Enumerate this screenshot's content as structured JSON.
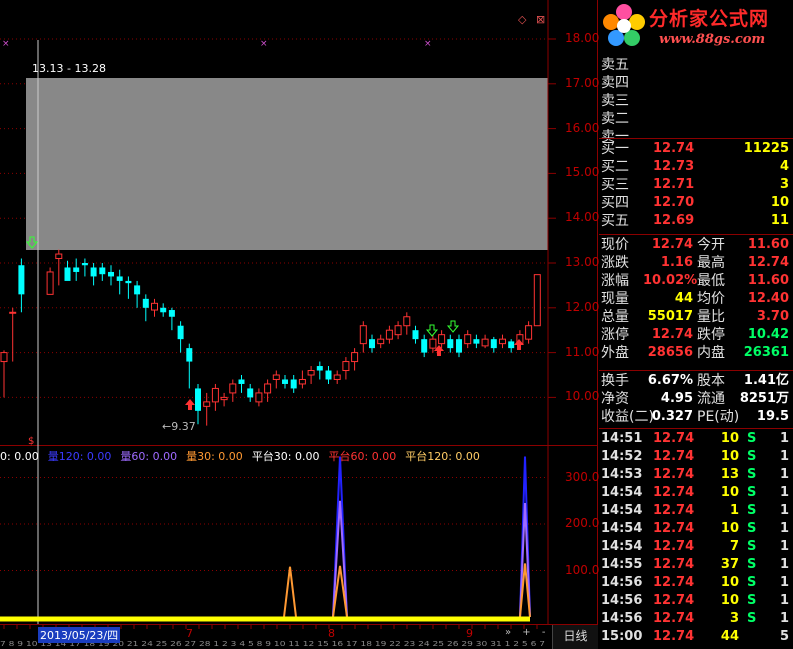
{
  "brand": {
    "name": "分析家公式网",
    "url": "www.88gs.com"
  },
  "price_chart": {
    "y_ticks": [
      "18.00",
      "17.00",
      "16.00",
      "15.00",
      "14.00",
      "13.00",
      "12.00",
      "11.00",
      "10.00"
    ],
    "range_label": "13.13 - 13.28",
    "low_label": "9.37",
    "top_icons": "◇ ⊠",
    "candles": [
      [
        10.0,
        11.0,
        10.8,
        11.05,
        "u"
      ],
      [
        10.8,
        11.9,
        11.9,
        12.0,
        "u"
      ],
      [
        11.9,
        12.95,
        12.3,
        13.1,
        "d"
      ],
      [
        12.3,
        12.8,
        12.3,
        12.9,
        "u"
      ],
      [
        12.5,
        13.2,
        13.1,
        13.3,
        "u"
      ],
      [
        12.8,
        12.9,
        12.6,
        13.05,
        "d"
      ],
      [
        12.6,
        12.8,
        12.9,
        13.1,
        "d"
      ],
      [
        12.7,
        13.0,
        12.95,
        13.1,
        "d"
      ],
      [
        12.5,
        12.9,
        12.7,
        13.0,
        "d"
      ],
      [
        12.6,
        12.75,
        12.9,
        13.0,
        "d"
      ],
      [
        12.5,
        12.7,
        12.8,
        12.95,
        "d"
      ],
      [
        12.3,
        12.6,
        12.7,
        12.85,
        "d"
      ],
      [
        12.2,
        12.55,
        12.6,
        12.7,
        "d"
      ],
      [
        12.0,
        12.3,
        12.5,
        12.6,
        "d"
      ],
      [
        11.7,
        12.0,
        12.2,
        12.3,
        "d"
      ],
      [
        11.8,
        11.95,
        12.1,
        12.2,
        "u"
      ],
      [
        11.8,
        11.9,
        12.0,
        12.1,
        "d"
      ],
      [
        11.5,
        11.8,
        11.95,
        12.0,
        "d"
      ],
      [
        11.0,
        11.3,
        11.6,
        11.7,
        "d"
      ],
      [
        10.2,
        10.8,
        11.1,
        11.2,
        "d"
      ],
      [
        9.4,
        9.7,
        10.2,
        10.3,
        "d"
      ],
      [
        9.37,
        9.8,
        9.9,
        10.1,
        "u"
      ],
      [
        9.7,
        9.9,
        10.2,
        10.3,
        "u"
      ],
      [
        9.8,
        9.95,
        10.0,
        10.1,
        "u"
      ],
      [
        9.9,
        10.1,
        10.3,
        10.4,
        "u"
      ],
      [
        10.1,
        10.3,
        10.4,
        10.5,
        "d"
      ],
      [
        9.9,
        10.0,
        10.2,
        10.3,
        "d"
      ],
      [
        9.8,
        9.9,
        10.1,
        10.2,
        "u"
      ],
      [
        9.9,
        10.1,
        10.3,
        10.4,
        "u"
      ],
      [
        10.2,
        10.4,
        10.5,
        10.6,
        "u"
      ],
      [
        10.2,
        10.3,
        10.4,
        10.5,
        "d"
      ],
      [
        10.1,
        10.2,
        10.4,
        10.5,
        "d"
      ],
      [
        10.2,
        10.3,
        10.4,
        10.6,
        "u"
      ],
      [
        10.3,
        10.5,
        10.6,
        10.7,
        "u"
      ],
      [
        10.4,
        10.6,
        10.7,
        10.8,
        "d"
      ],
      [
        10.3,
        10.4,
        10.6,
        10.7,
        "d"
      ],
      [
        10.3,
        10.4,
        10.5,
        10.6,
        "u"
      ],
      [
        10.4,
        10.6,
        10.8,
        10.9,
        "u"
      ],
      [
        10.6,
        10.8,
        11.0,
        11.1,
        "u"
      ],
      [
        11.0,
        11.2,
        11.6,
        11.7,
        "u"
      ],
      [
        11.0,
        11.1,
        11.3,
        11.4,
        "d"
      ],
      [
        11.1,
        11.2,
        11.3,
        11.4,
        "u"
      ],
      [
        11.2,
        11.3,
        11.5,
        11.6,
        "u"
      ],
      [
        11.3,
        11.4,
        11.6,
        11.7,
        "u"
      ],
      [
        11.4,
        11.6,
        11.8,
        11.9,
        "u"
      ],
      [
        11.2,
        11.3,
        11.5,
        11.6,
        "d"
      ],
      [
        10.9,
        11.0,
        11.3,
        11.4,
        "d"
      ],
      [
        11.0,
        11.1,
        11.3,
        11.4,
        "u"
      ],
      [
        11.1,
        11.2,
        11.4,
        11.5,
        "u"
      ],
      [
        11.0,
        11.1,
        11.3,
        11.4,
        "d"
      ],
      [
        10.9,
        11.0,
        11.3,
        11.4,
        "d"
      ],
      [
        11.1,
        11.2,
        11.4,
        11.5,
        "u"
      ],
      [
        11.1,
        11.2,
        11.3,
        11.4,
        "d"
      ],
      [
        11.1,
        11.15,
        11.3,
        11.4,
        "u"
      ],
      [
        11.0,
        11.1,
        11.3,
        11.35,
        "d"
      ],
      [
        11.1,
        11.2,
        11.3,
        11.4,
        "u"
      ],
      [
        11.0,
        11.1,
        11.25,
        11.3,
        "d"
      ],
      [
        11.1,
        11.2,
        11.4,
        11.5,
        "u"
      ],
      [
        11.2,
        11.3,
        11.6,
        11.7,
        "u"
      ],
      [
        11.6,
        11.6,
        12.74,
        12.74,
        "u"
      ]
    ]
  },
  "indicator": {
    "legend": [
      {
        "text": "0: 0.00",
        "color": "#ffffff"
      },
      {
        "text": "量120: 0.00",
        "color": "#3b3bff"
      },
      {
        "text": "量60: 0.00",
        "color": "#9f6bff"
      },
      {
        "text": "量30: 0.00",
        "color": "#ff9933"
      },
      {
        "text": "平台30: 0.00",
        "color": "#ffffff"
      },
      {
        "text": "平台60: 0.00",
        "color": "#ff3333"
      },
      {
        "text": "平台120: 0.00",
        "color": "#ffcc66"
      }
    ],
    "y_ticks": [
      "300.0",
      "200.0",
      "100.0"
    ]
  },
  "date_axis": {
    "selected_date": "2013/05/23/四",
    "months": [
      "7",
      "8",
      "9"
    ],
    "day_ticks": "7 8 9 10 13 14 17 18 19 20 21 24 25 26 27 28 1 2 3 4 5 8 9 10 11 12 15 16 17 18 19 22 23 24 25 26 29 30 31 1 2 5 6 7",
    "period": "日线",
    "nav": "» + -"
  },
  "order_book": {
    "asks": [
      {
        "label": "卖五"
      },
      {
        "label": "卖四"
      },
      {
        "label": "卖三"
      },
      {
        "label": "卖二"
      },
      {
        "label": "卖一"
      }
    ],
    "bids": [
      {
        "label": "买一",
        "price": "12.74",
        "vol": "11225"
      },
      {
        "label": "买二",
        "price": "12.73",
        "vol": "4"
      },
      {
        "label": "买三",
        "price": "12.71",
        "vol": "3"
      },
      {
        "label": "买四",
        "price": "12.70",
        "vol": "10"
      },
      {
        "label": "买五",
        "price": "12.69",
        "vol": "11"
      }
    ]
  },
  "quote": [
    {
      "l1": "现价",
      "v1": "12.74",
      "c1": "#ff3333",
      "l2": "今开",
      "v2": "11.60",
      "c2": "#ff3333"
    },
    {
      "l1": "涨跌",
      "v1": "1.16",
      "c1": "#ff3333",
      "l2": "最高",
      "v2": "12.74",
      "c2": "#ff3333"
    },
    {
      "l1": "涨幅",
      "v1": "10.02%",
      "c1": "#ff3333",
      "l2": "最低",
      "v2": "11.60",
      "c2": "#ff3333"
    },
    {
      "l1": "现量",
      "v1": "44",
      "c1": "#ffff00",
      "l2": "均价",
      "v2": "12.40",
      "c2": "#ff3333"
    },
    {
      "l1": "总量",
      "v1": "55017",
      "c1": "#ffff00",
      "l2": "量比",
      "v2": "3.70",
      "c2": "#ff3333"
    },
    {
      "l1": "涨停",
      "v1": "12.74",
      "c1": "#ff3333",
      "l2": "跌停",
      "v2": "10.42",
      "c2": "#00ff66"
    },
    {
      "l1": "外盘",
      "v1": "28656",
      "c1": "#ff3333",
      "l2": "内盘",
      "v2": "26361",
      "c2": "#00ff66"
    }
  ],
  "finance": [
    {
      "l1": "换手",
      "v1": "6.67%",
      "l2": "股本",
      "v2": "1.41亿"
    },
    {
      "l1": "净资",
      "v1": "4.95",
      "l2": "流通",
      "v2": "8251万"
    },
    {
      "l1": "收益(二)",
      "v1": "0.327",
      "l2": "PE(动)",
      "v2": "19.5"
    }
  ],
  "ticks": [
    {
      "time": "14:51",
      "price": "12.74",
      "vol": "10",
      "side": "S",
      "n": "1"
    },
    {
      "time": "14:52",
      "price": "12.74",
      "vol": "10",
      "side": "S",
      "n": "1"
    },
    {
      "time": "14:53",
      "price": "12.74",
      "vol": "13",
      "side": "S",
      "n": "1"
    },
    {
      "time": "14:54",
      "price": "12.74",
      "vol": "10",
      "side": "S",
      "n": "1"
    },
    {
      "time": "14:54",
      "price": "12.74",
      "vol": "1",
      "side": "S",
      "n": "1"
    },
    {
      "time": "14:54",
      "price": "12.74",
      "vol": "10",
      "side": "S",
      "n": "1"
    },
    {
      "time": "14:54",
      "price": "12.74",
      "vol": "7",
      "side": "S",
      "n": "1"
    },
    {
      "time": "14:55",
      "price": "12.74",
      "vol": "37",
      "side": "S",
      "n": "1"
    },
    {
      "time": "14:56",
      "price": "12.74",
      "vol": "10",
      "side": "S",
      "n": "1"
    },
    {
      "time": "14:56",
      "price": "12.74",
      "vol": "10",
      "side": "S",
      "n": "1"
    },
    {
      "time": "14:56",
      "price": "12.74",
      "vol": "3",
      "side": "S",
      "n": "1"
    },
    {
      "time": "15:00",
      "price": "12.74",
      "vol": "44",
      "side": "",
      "n": "5"
    }
  ],
  "colors": {
    "up": "#ff3333",
    "down": "#00ffff",
    "grid": "#8b0000",
    "label": "#c00000",
    "highlight": "#888888"
  }
}
